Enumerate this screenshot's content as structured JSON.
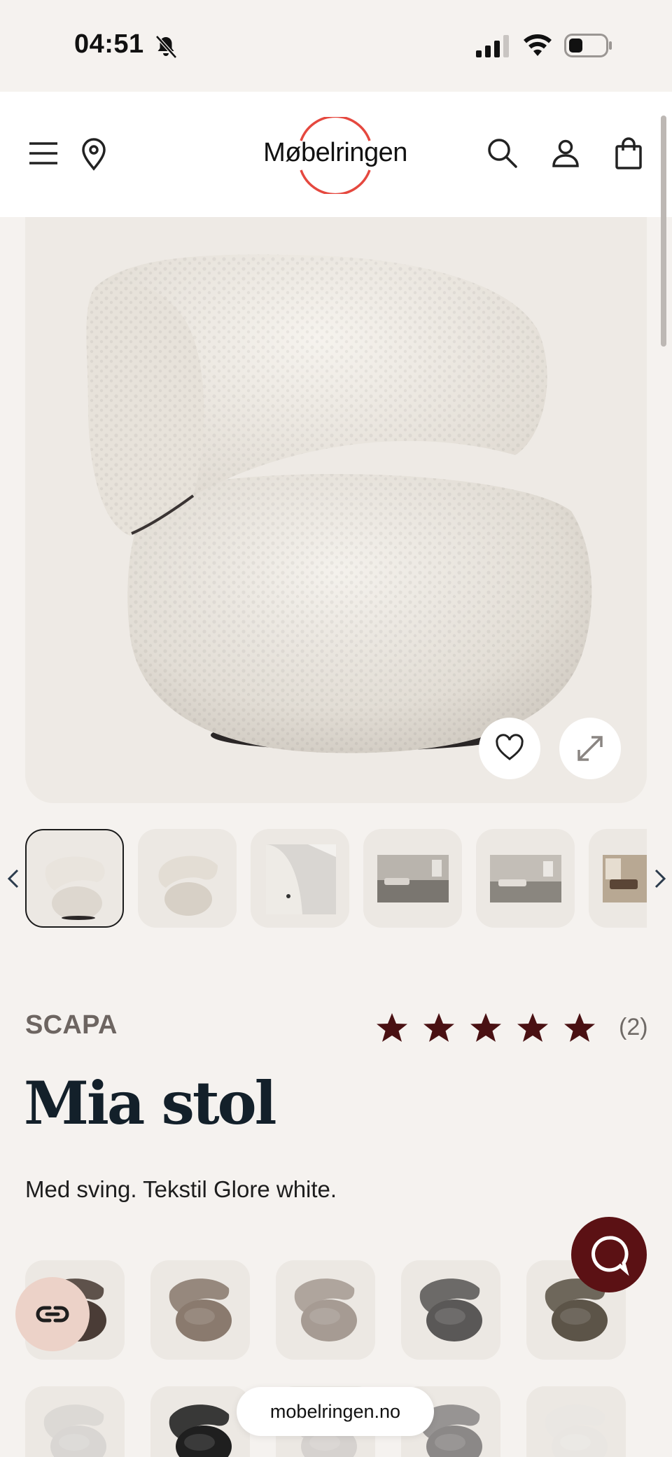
{
  "status_bar": {
    "time": "04:51",
    "icons": [
      "bell-slash-icon",
      "signal-icon",
      "wifi-icon",
      "battery-icon"
    ]
  },
  "header": {
    "logo_text": "Møbelringen",
    "icons": [
      "menu-icon",
      "location-pin-icon",
      "search-icon",
      "account-icon",
      "shopping-bag-icon"
    ]
  },
  "gallery": {
    "buttons": [
      "heart-icon",
      "expand-icon"
    ],
    "thumbnail_count_visible": 6,
    "active_thumbnail": 1
  },
  "product": {
    "brand": "SCAPA",
    "rating": 5,
    "review_count": "(2)",
    "title": "Mia stol",
    "description": "Med sving. Tekstil Glore white."
  },
  "variants": {
    "row1_colors": [
      "#4a3c36",
      "#8a7a6e",
      "#a69b93",
      "#5a5857",
      "#5c5448"
    ],
    "row2_colors": [
      "#d9d6d3",
      "#1f1f1f",
      "#d6d2cf",
      "#8b8887",
      "#e9e6e2"
    ]
  },
  "browser": {
    "url": "mobelringen.no"
  },
  "colors": {
    "brand_red": "#e5483f",
    "star": "#4a1113",
    "chat_button": "#5b1114",
    "background": "#f5f2ef"
  }
}
